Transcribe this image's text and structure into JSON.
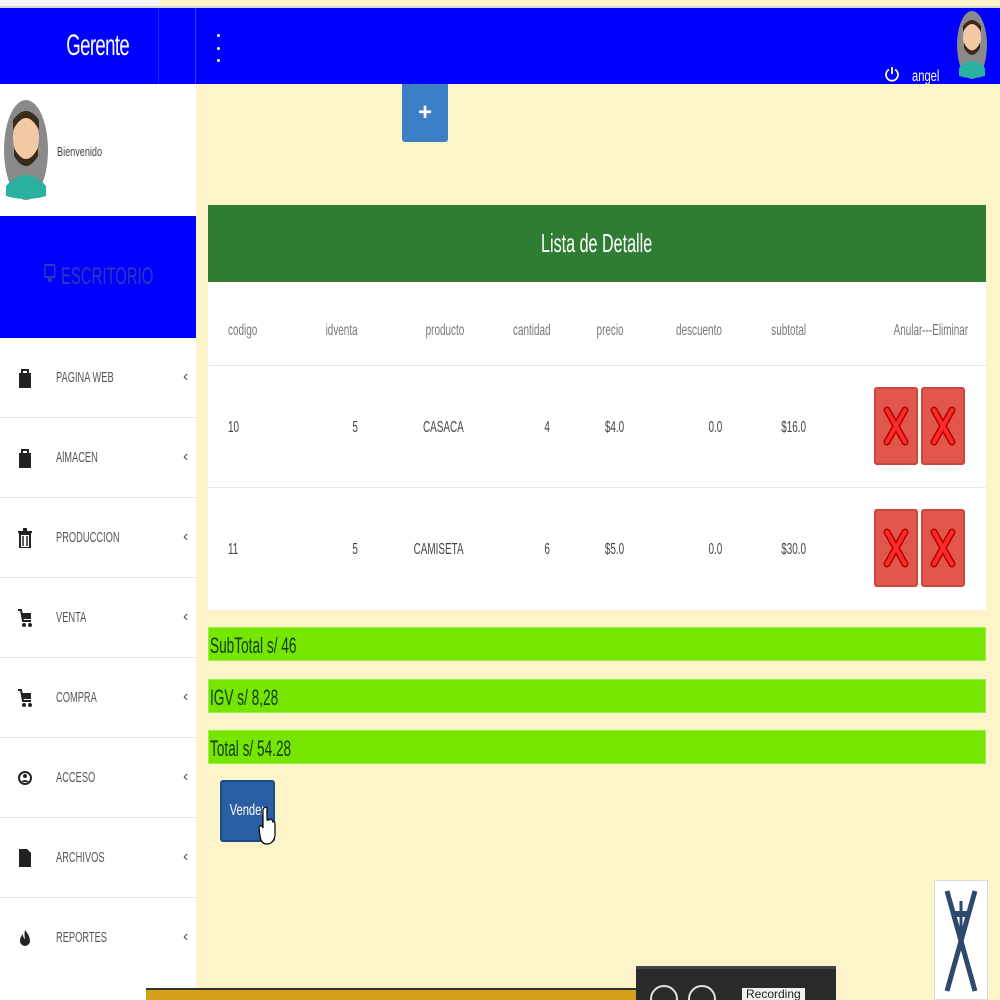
{
  "app": {
    "brand": "Gerente",
    "user_name": "angel"
  },
  "sidebar": {
    "welcome": "Bienvenido",
    "desk_label": "ESCRITORIO",
    "items": [
      {
        "label": "PAGINA WEB",
        "icon": "bag-icon"
      },
      {
        "label": "AlMACEN",
        "icon": "bag-icon"
      },
      {
        "label": "PRODUCCION",
        "icon": "trash-icon"
      },
      {
        "label": "VENTA",
        "icon": "cart-icon"
      },
      {
        "label": "COMPRA",
        "icon": "cart-icon"
      },
      {
        "label": "ACCESO",
        "icon": "user-circle-icon"
      },
      {
        "label": "ARCHIVOS",
        "icon": "file-icon"
      },
      {
        "label": "REPORTES",
        "icon": "fire-icon"
      }
    ]
  },
  "toolbar": {
    "add_label": "+"
  },
  "detail": {
    "title": "Lista de Detalle",
    "columns": [
      "codigo",
      "idventa",
      "producto",
      "cantidad",
      "precio",
      "descuento",
      "subtotal",
      "Anular---Eliminar"
    ],
    "rows": [
      {
        "codigo": "10",
        "idventa": "5",
        "producto": "CASACA",
        "cantidad": "4",
        "precio": "$4.0",
        "descuento": "0.0",
        "subtotal": "$16.0"
      },
      {
        "codigo": "11",
        "idventa": "5",
        "producto": "CAMISETA",
        "cantidad": "6",
        "precio": "$5.0",
        "descuento": "0.0",
        "subtotal": "$30.0"
      }
    ]
  },
  "totals": {
    "subtotal": "SubTotal s/ 46",
    "igv": "IGV s/ 8,28",
    "total": "Total s/ 54.28"
  },
  "actions": {
    "sell_label": "Vender"
  },
  "recorder": {
    "label": "Recording"
  },
  "colors": {
    "topbar": "#0000ff",
    "panel_header": "#2e7d32",
    "totals_bar": "#76e600",
    "delete_button": "#e2574c",
    "content_bg": "#fdf5c9"
  }
}
